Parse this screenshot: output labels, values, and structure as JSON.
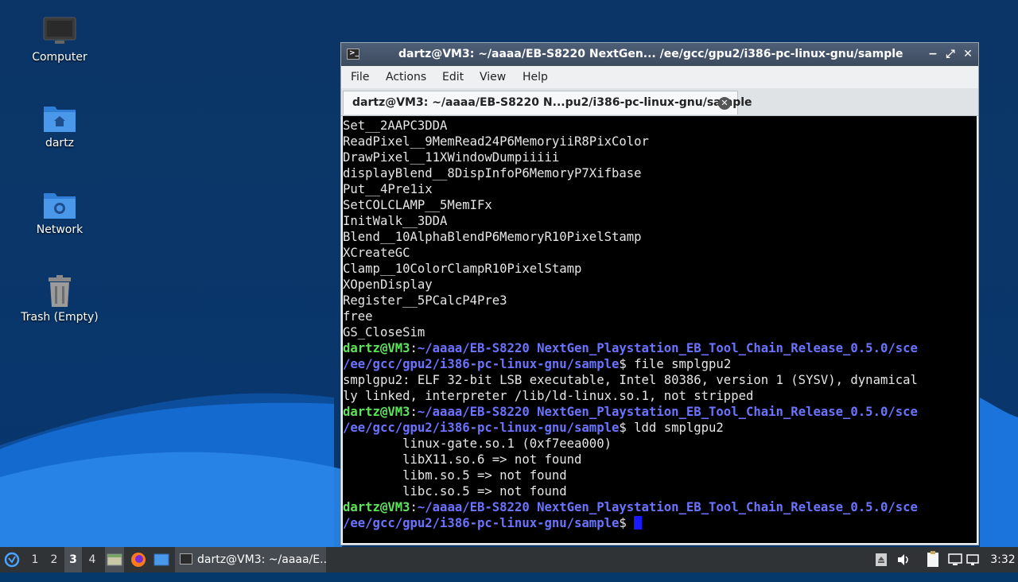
{
  "desktop": {
    "icons": [
      {
        "label": "Computer",
        "icon": "computer-icon"
      },
      {
        "label": "dartz",
        "icon": "home-folder-icon"
      },
      {
        "label": "Network",
        "icon": "network-folder-icon"
      },
      {
        "label": "Trash (Empty)",
        "icon": "trash-icon"
      }
    ]
  },
  "window": {
    "title": "dartz@VM3: ~/aaaa/EB-S8220 NextGen... /ee/gcc/gpu2/i386-pc-linux-gnu/sample",
    "menu": [
      "File",
      "Actions",
      "Edit",
      "View",
      "Help"
    ],
    "tab_label": "dartz@VM3: ~/aaaa/EB-S8220 N...pu2/i386-pc-linux-gnu/sample",
    "buttons": {
      "minimize": "−",
      "maximize": "⤢",
      "close": "✕"
    }
  },
  "terminal": {
    "prompt_user": "dartz@VM3",
    "prompt_path_line1": "~/aaaa/EB-S8220 NextGen_Playstation_EB_Tool_Chain_Release_0.5.0/sce",
    "prompt_path_line2": "/ee/gcc/gpu2/i386-pc-linux-gnu/sample",
    "output_lines": [
      "Set__2AAPC3DDA",
      "ReadPixel__9MemRead24P6MemoryiiR8PixColor",
      "DrawPixel__11XWindowDumpiiiii",
      "displayBlend__8DispInfoP6MemoryP7Xifbase",
      "Put__4Pre1ix",
      "SetCOLCLAMP__5MemIFx",
      "InitWalk__3DDA",
      "Blend__10AlphaBlendP6MemoryR10PixelStamp",
      "XCreateGC",
      "Clamp__10ColorClampR10PixelStamp",
      "XOpenDisplay",
      "Register__5PCalcP4Pre3",
      "free",
      "GS_CloseSim"
    ],
    "cmd1": " file smplgpu2",
    "file_output_1": "smplgpu2: ELF 32-bit LSB executable, Intel 80386, version 1 (SYSV), dynamical",
    "file_output_2": "ly linked, interpreter /lib/ld-linux.so.1, not stripped",
    "cmd2": " ldd smplgpu2",
    "ldd_lines": [
      "        linux-gate.so.1 (0xf7eea000)",
      "        libX11.so.6 => not found",
      "        libm.so.5 => not found",
      "        libc.so.5 => not found"
    ],
    "colon": ":",
    "dollar": "$"
  },
  "taskbar": {
    "workspaces": [
      "1",
      "2",
      "3",
      "4"
    ],
    "active_workspace": "3",
    "task_label": "dartz@VM3: ~/aaaa/E...",
    "clock": "3:32"
  },
  "colors": {
    "prompt_user": "#5fe35f",
    "prompt_path": "#6b73ff",
    "terminal_bg": "#000000",
    "titlebar": "#46566b"
  }
}
